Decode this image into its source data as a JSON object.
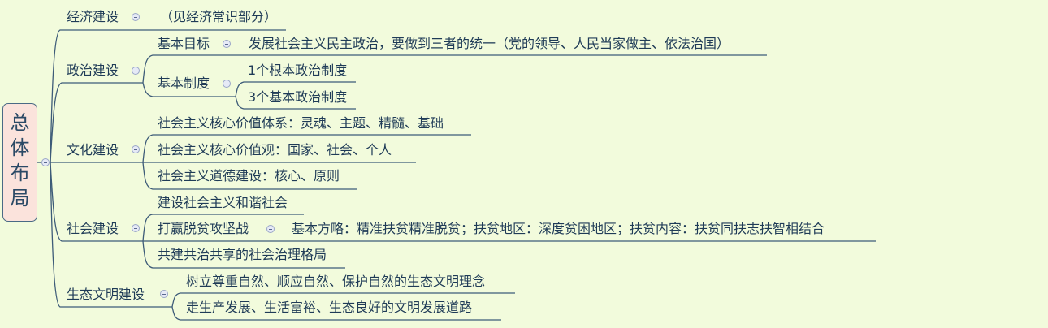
{
  "root": {
    "label_lines": [
      "总",
      "体",
      "布",
      "局"
    ]
  },
  "economy": {
    "label": "经济建设",
    "note": "（见经济常识部分）"
  },
  "politics": {
    "label": "政治建设",
    "goal": {
      "label": "基本目标",
      "detail": "发展社会主义民主政治，要做到三者的统一（党的领导、人民当家做主、依法治国）"
    },
    "system": {
      "label": "基本制度",
      "items": [
        "1个根本政治制度",
        "3个基本政治制度"
      ]
    }
  },
  "culture": {
    "label": "文化建设",
    "items": [
      "社会主义核心价值体系：灵魂、主题、精髓、基础",
      "社会主义核心价值观：国家、社会、个人",
      "社会主义道德建设：核心、原则"
    ]
  },
  "society": {
    "label": "社会建设",
    "harmony": "建设社会主义和谐社会",
    "poverty": {
      "label": "打赢脱贫攻坚战",
      "detail": "基本方略：精准扶贫精准脱贫；扶贫地区：深度贫困地区；扶贫内容：扶贫同扶志扶智相结合"
    },
    "governance": "共建共治共享的社会治理格局"
  },
  "ecology": {
    "label": "生态文明建设",
    "items": [
      "树立尊重自然、顺应自然、保护自然的生态文明理念",
      "走生产发展、生活富裕、生态良好的文明发展道路"
    ]
  },
  "colors": {
    "background": "#f2fbdc",
    "line": "#3d5b78",
    "root_fill": "#fbe3dc"
  }
}
